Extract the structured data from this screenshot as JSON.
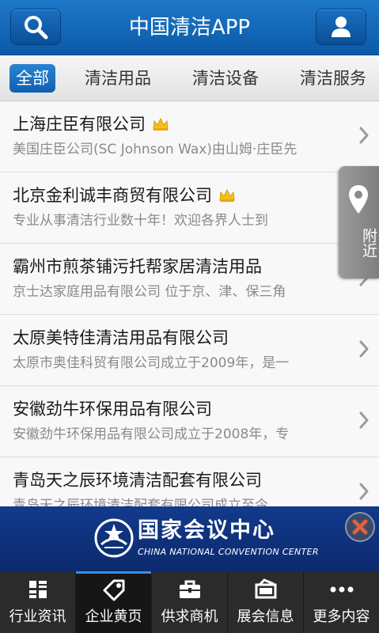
{
  "header": {
    "title": "中国清洁APP",
    "search_icon": "search-icon",
    "user_icon": "user-icon"
  },
  "tabs": [
    {
      "label": "全部",
      "active": true
    },
    {
      "label": "清洁用品",
      "active": false
    },
    {
      "label": "清洁设备",
      "active": false
    },
    {
      "label": "清洁服务",
      "active": false
    }
  ],
  "list": [
    {
      "title": "上海庄臣有限公司",
      "crown": true,
      "desc": "美国庄臣公司(SC Johnson Wax)由山姆·庄臣先"
    },
    {
      "title": "北京金利诚丰商贸有限公司",
      "crown": true,
      "desc": "专业从事清洁行业数十年！欢迎各界人士到"
    },
    {
      "title": "霸州市煎茶铺污托帮家居清洁用品",
      "crown": false,
      "desc": "京士达家庭用品有限公司 位于京、津、保三角"
    },
    {
      "title": "太原美特佳清洁用品有限公司",
      "crown": false,
      "desc": "太原市奥佳科贸有限公司成立于2009年，是一"
    },
    {
      "title": "安徽劲牛环保用品有限公司",
      "crown": false,
      "desc": "安徽劲牛环保用品有限公司成立于2008年，专"
    },
    {
      "title": "青岛天之辰环境清洁配套有限公司",
      "crown": false,
      "desc": "青岛天之辰环境清洁配套有限公司成立至今"
    }
  ],
  "nearby": {
    "label": "附近",
    "icon": "location-pin-icon"
  },
  "ad": {
    "title_cn": "国家会议中心",
    "title_en": "CHINA NATIONAL CONVENTION CENTER",
    "close_icon": "close-icon"
  },
  "bottom_nav": [
    {
      "label": "行业资讯",
      "icon": "grid-icon",
      "active": false
    },
    {
      "label": "企业黄页",
      "icon": "tag-icon",
      "active": true
    },
    {
      "label": "供求商机",
      "icon": "briefcase-icon",
      "active": false
    },
    {
      "label": "展会信息",
      "icon": "ticket-icon",
      "active": false
    },
    {
      "label": "更多内容",
      "icon": "more-icon",
      "active": false
    }
  ],
  "colors": {
    "header_blue": "#0a5aa8",
    "tab_active": "#1a73c4",
    "nav_bg": "#2b2b2b"
  }
}
